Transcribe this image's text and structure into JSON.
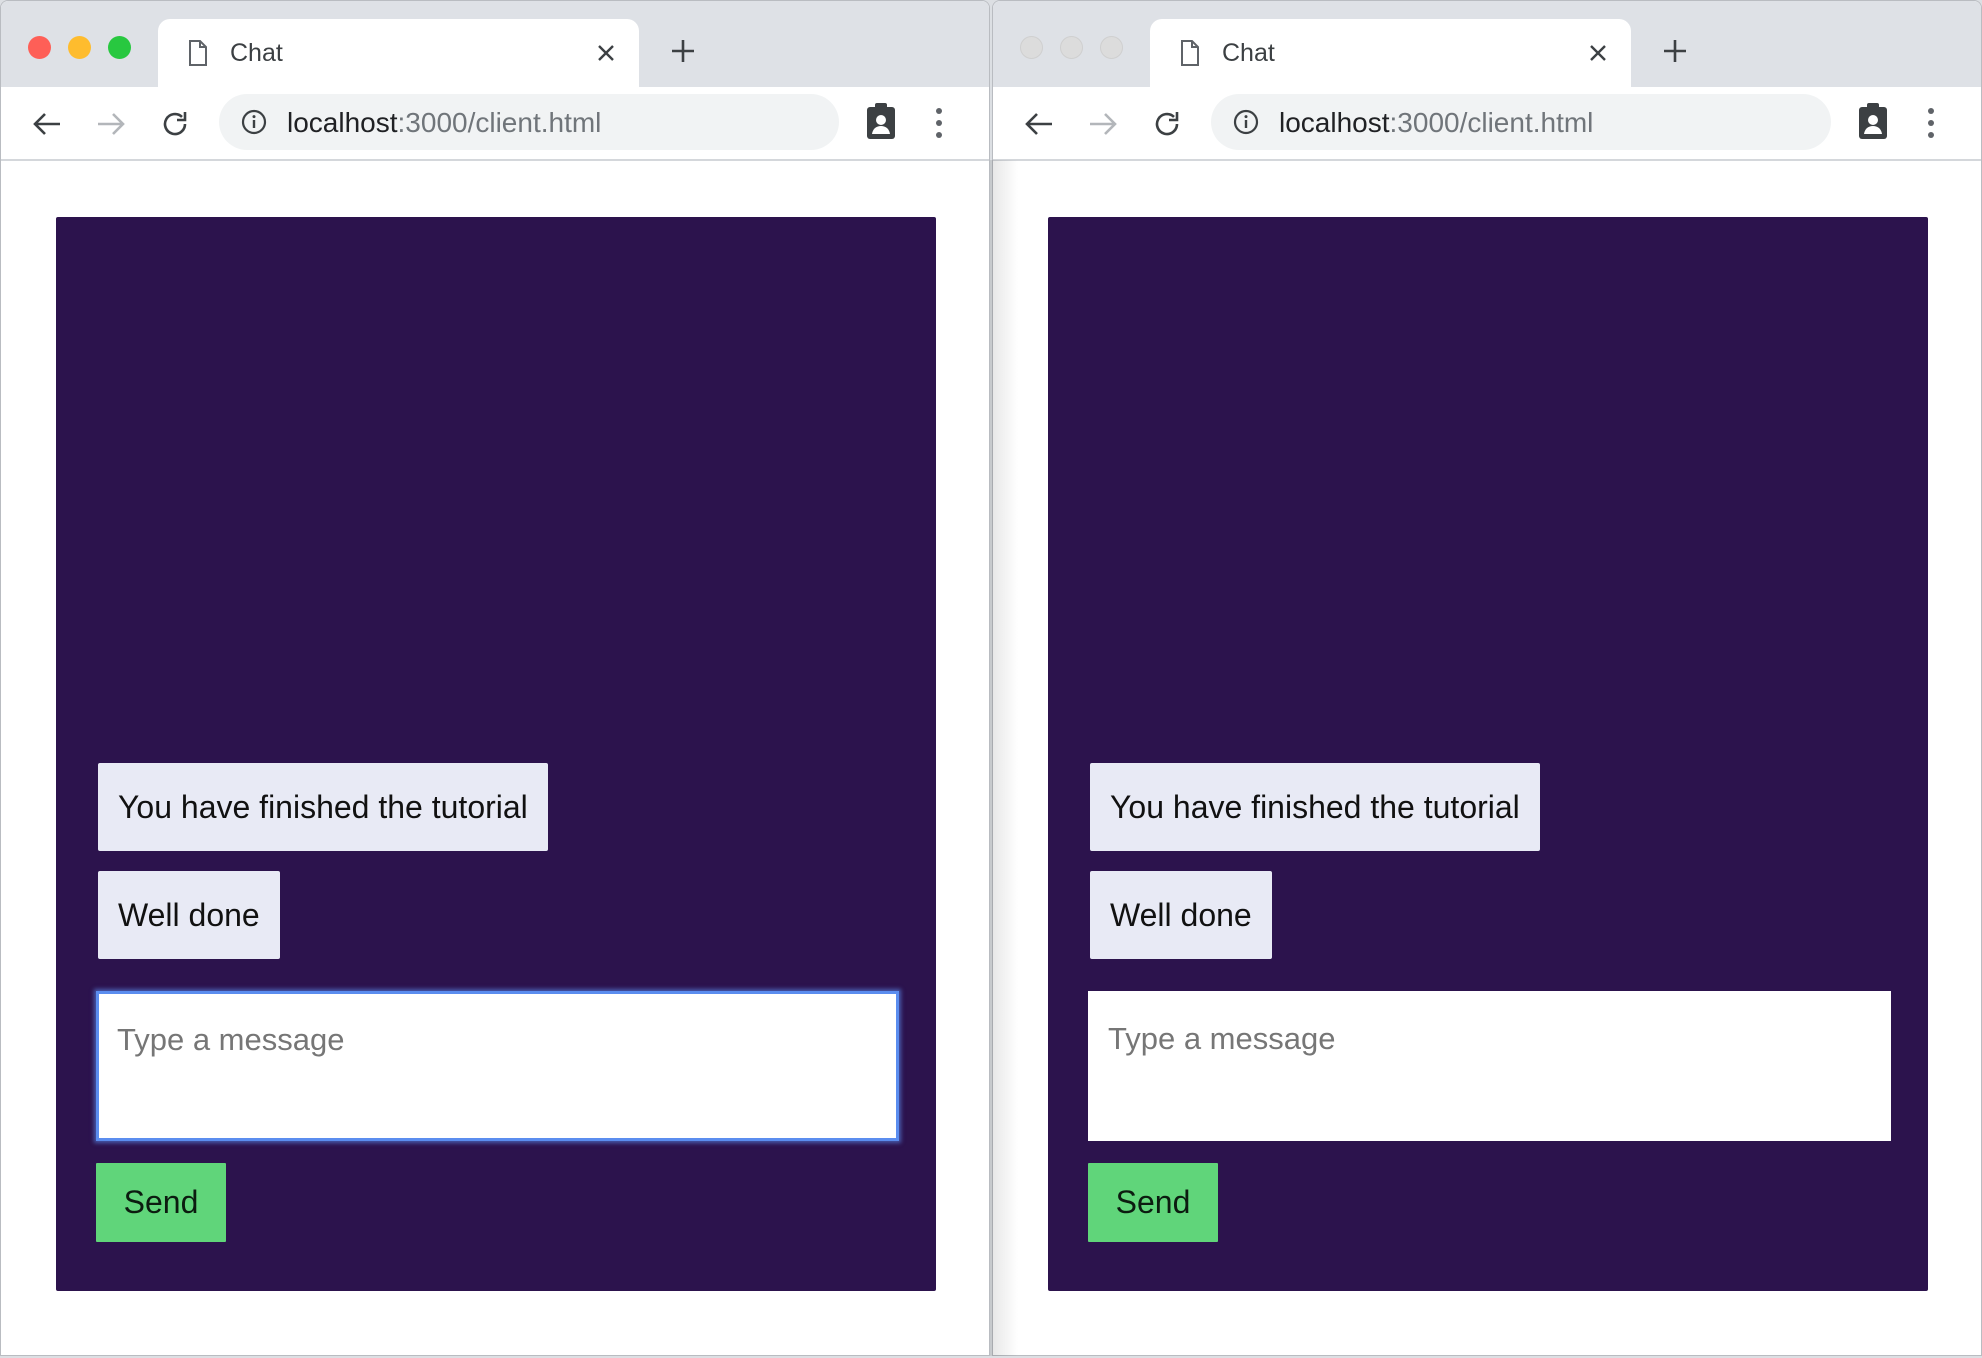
{
  "colors": {
    "chat_background": "#2c134d",
    "message_bubble": "#e8eaf5",
    "send_button": "#60d57a",
    "focus_ring": "#5b8def",
    "traffic_red": "#fe5f57",
    "traffic_yellow": "#febc2e",
    "traffic_green": "#28c840"
  },
  "windows": [
    {
      "tab": {
        "title": "Chat",
        "icon": "document-icon",
        "close_icon": "close-icon"
      },
      "new_tab_icon": "plus-icon",
      "address": {
        "host": "localhost",
        "rest": ":3000/client.html"
      },
      "chat": {
        "messages": [
          "You have finished the tutorial",
          "Well done"
        ],
        "input_placeholder": "Type a message",
        "send_label": "Send"
      },
      "focused_input": true,
      "active": true
    },
    {
      "tab": {
        "title": "Chat",
        "icon": "document-icon",
        "close_icon": "close-icon"
      },
      "new_tab_icon": "plus-icon",
      "address": {
        "host": "localhost",
        "rest": ":3000/client.html"
      },
      "chat": {
        "messages": [
          "You have finished the tutorial",
          "Well done"
        ],
        "input_placeholder": "Type a message",
        "send_label": "Send"
      },
      "focused_input": false,
      "active": false
    }
  ]
}
